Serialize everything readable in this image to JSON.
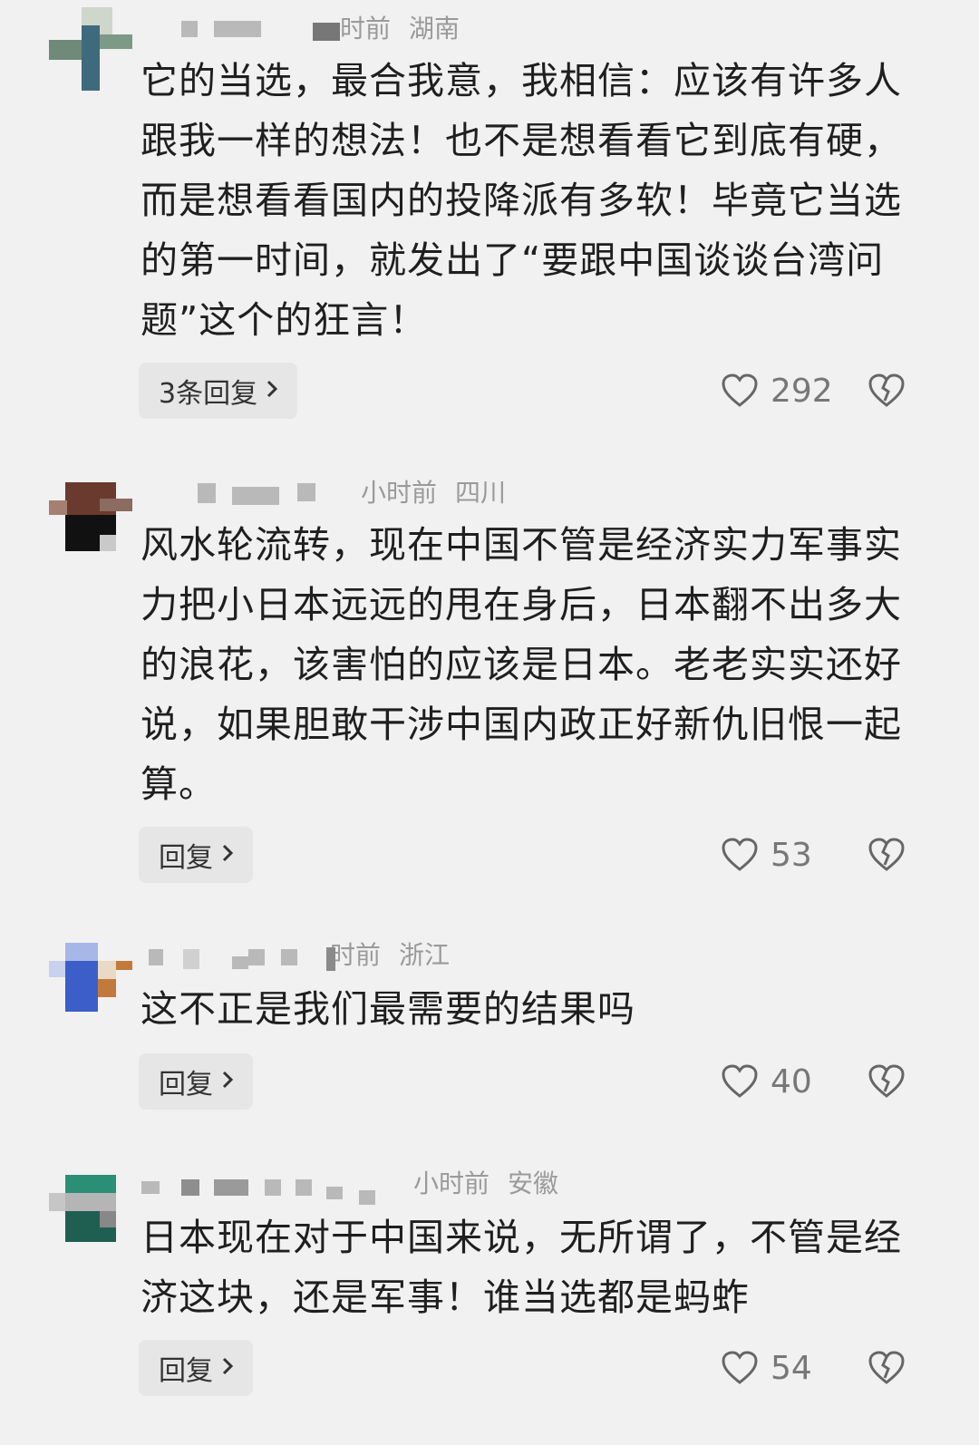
{
  "comments": [
    {
      "time": "时前",
      "location": "湖南",
      "text": "它的当选，最合我意，我相信：应该有许多人跟我一样的想法！也不是想看看它到底有硬，而是想看看国内的投降派有多软！毕竟它当选的第一时间，就发出了“要跟中国谈谈台湾问题”这个的狂言！",
      "reply_label": "3条回复",
      "likes": "292",
      "avatar_colors": [
        "#3e6a7e",
        "#7c9a86",
        "#c9d0c6",
        "#5b5b63"
      ]
    },
    {
      "time": "小时前",
      "location": "四川",
      "text": "风水轮流转，现在中国不管是经济实力军事实力把小日本远远的甩在身后，日本翻不出多大的浪花，该害怕的应该是日本。老老实实还好说，如果胆敢干涉中国内政正好新仇旧恨一起算。",
      "reply_label": "回复",
      "likes": "53",
      "avatar_colors": [
        "#6b3a2e",
        "#2b2424",
        "#a58070",
        "#111111"
      ]
    },
    {
      "time": "时前",
      "location": "浙江",
      "text": "这不正是我们最需要的结果吗",
      "reply_label": "回复",
      "likes": "40",
      "avatar_colors": [
        "#3b5ec9",
        "#a6b6e6",
        "#c27a3c",
        "#e9d9c5"
      ]
    },
    {
      "time": "小时前",
      "location": "安徽",
      "text": "日本现在对于中国来说，无所谓了，不管是经济这块，还是军事！谁当选都是蚂蚱",
      "reply_label": "回复",
      "likes": "54",
      "avatar_colors": [
        "#2b8f76",
        "#1f5f52",
        "#c6c6c6",
        "#888888"
      ]
    }
  ]
}
